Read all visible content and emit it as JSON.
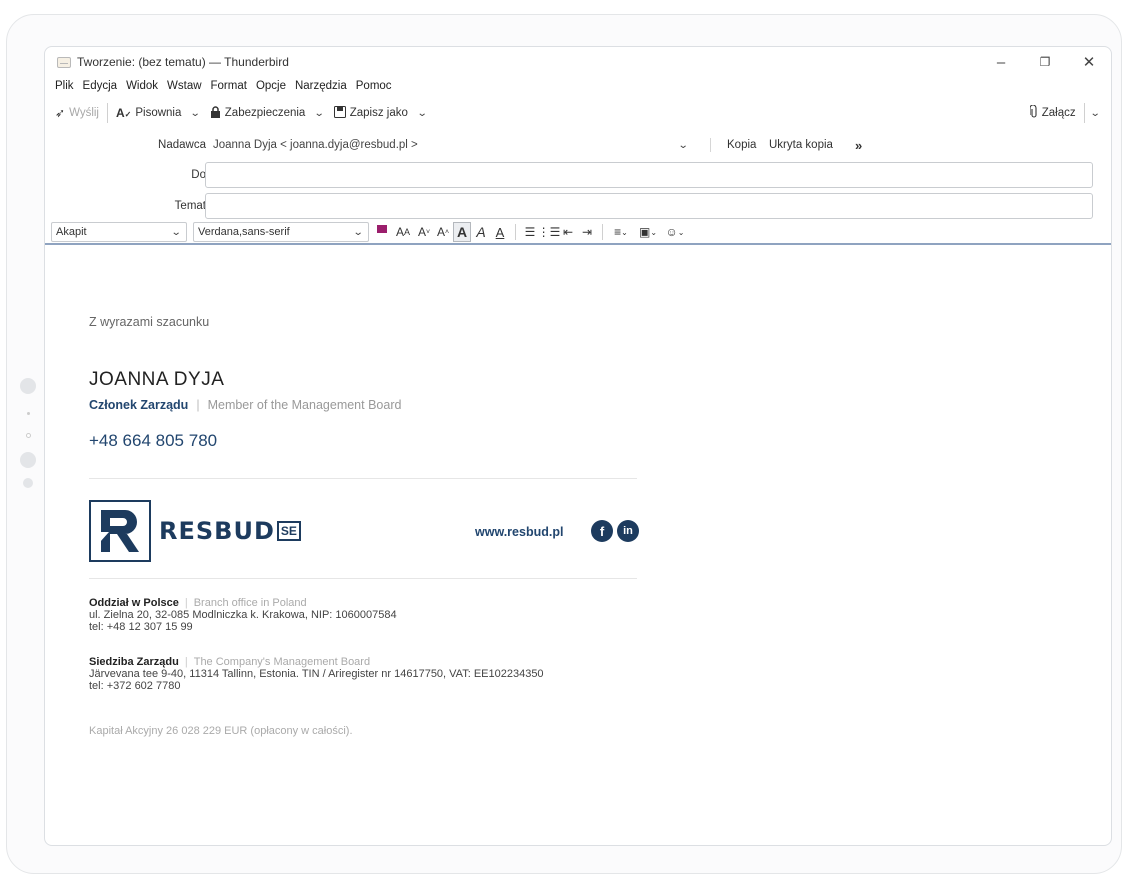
{
  "window": {
    "title": "Tworzenie: (bez tematu) — Thunderbird",
    "controls": {
      "minimize": "–",
      "restore": "❐",
      "close": "✕"
    }
  },
  "menu": [
    "Plik",
    "Edycja",
    "Widok",
    "Wstaw",
    "Format",
    "Opcje",
    "Narzędzia",
    "Pomoc"
  ],
  "toolbar": {
    "send": "Wyślij",
    "spelling": "Pisownia",
    "security": "Zabezpieczenia",
    "save_as": "Zapisz jako",
    "attach": "Załącz"
  },
  "headers": {
    "from_label": "Nadawca",
    "from_value": "Joanna Dyja < joanna.dyja@resbud.pl >",
    "cc": "Kopia",
    "bcc": "Ukryta kopia",
    "to_label": "Do",
    "to_value": "",
    "subject_label": "Temat",
    "subject_value": ""
  },
  "format": {
    "paragraph": "Akapit",
    "font": "Verdana,sans-serif",
    "text_color": "#9b1e6c"
  },
  "signature": {
    "greeting": "Z wyrazami szacunku",
    "name": "JOANNA DYJA",
    "role_pl": "Członek Zarządu",
    "role_sep": "|",
    "role_en": "Member of the Management Board",
    "phone": "+48 664 805 780",
    "logo_text": "RESBUD",
    "logo_suffix": "SE",
    "website": "www.resbud.pl",
    "branch_title": "Oddział w Polsce",
    "branch_en": "Branch office in Poland",
    "branch_line1": "ul. Zielna 20, 32-085 Modlniczka k. Krakowa, NIP: 1060007584",
    "branch_line2": "tel: +48 12 307 15 99",
    "hq_title": "Siedziba Zarządu",
    "hq_en": "The Company's Management Board",
    "hq_line1": "Järvevana tee 9-40, 11314 Tallinn, Estonia. TIN / Ariregister nr 14617750, VAT: EE102234350",
    "hq_line2": "tel: +372 602 7780",
    "capital": "Kapitał Akcyjny 26 028 229 EUR (opłacony w całości).",
    "brand_color": "#1d3b5e"
  }
}
